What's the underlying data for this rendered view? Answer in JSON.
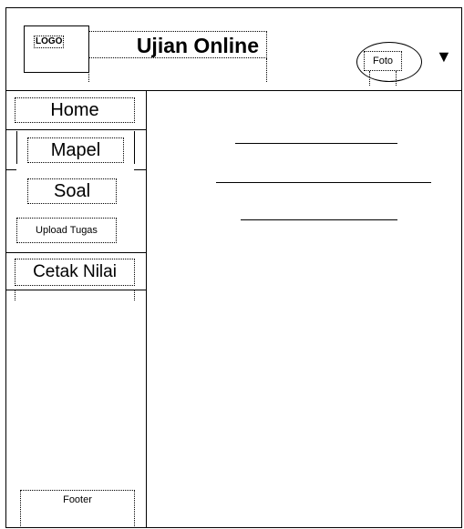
{
  "header": {
    "logo": "LOGO",
    "title": "Ujian Online",
    "profile": {
      "photo_label": "Foto",
      "dropdown_icon": "triangle-down-icon"
    }
  },
  "sidebar": {
    "items": [
      {
        "label": "Home"
      },
      {
        "label": "Mapel"
      },
      {
        "label": "Soal"
      },
      {
        "label": "Upload Tugas"
      },
      {
        "label": "Cetak Nilai"
      }
    ],
    "footer": "Footer"
  },
  "main": {
    "placeholder_lines": 3
  }
}
